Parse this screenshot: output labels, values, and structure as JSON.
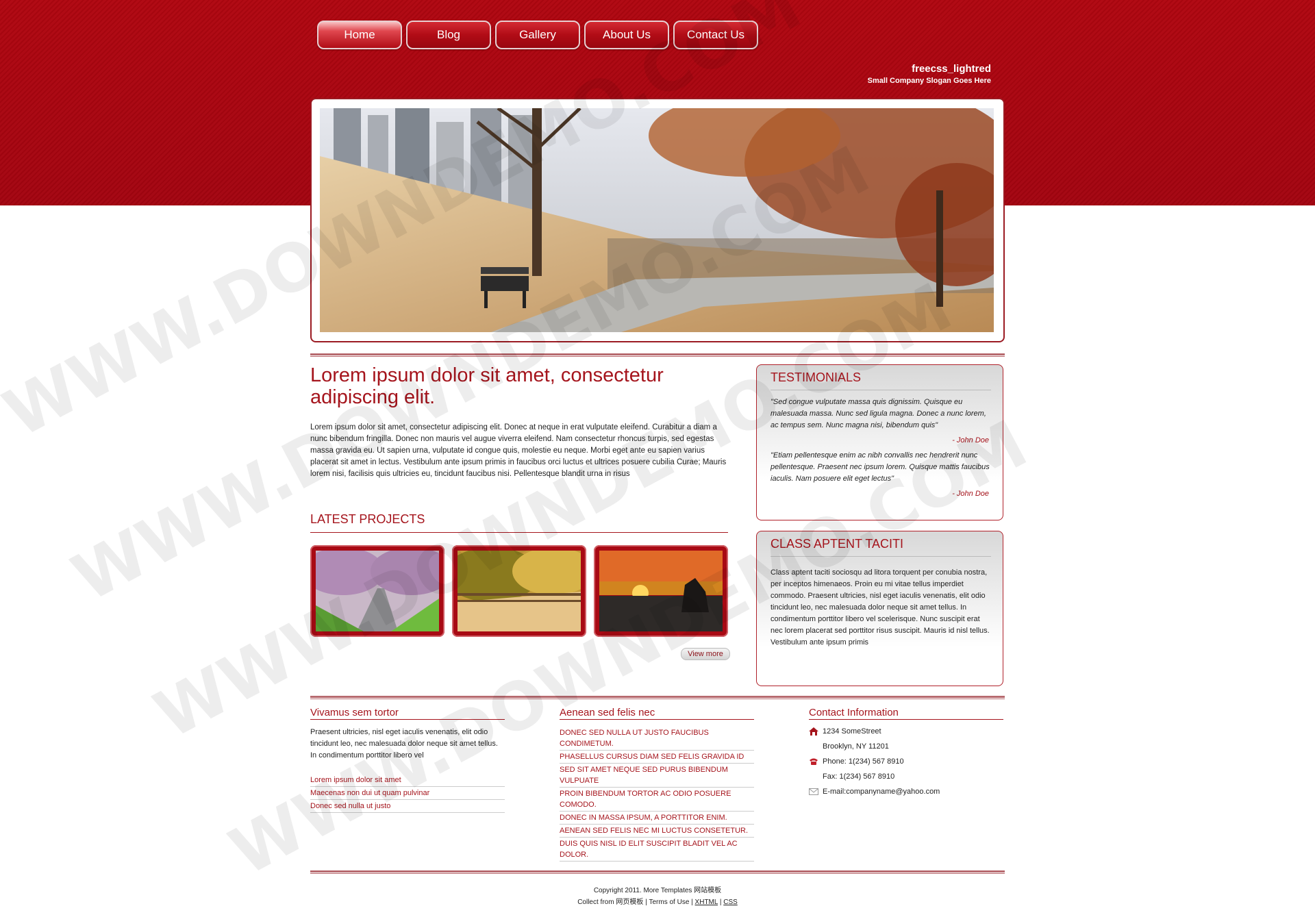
{
  "nav": [
    {
      "label": "Home",
      "active": true
    },
    {
      "label": "Blog"
    },
    {
      "label": "Gallery"
    },
    {
      "label": "About Us"
    },
    {
      "label": "Contact Us"
    }
  ],
  "brand": {
    "name": "freecss_lightred",
    "slogan": "Small Company Slogan Goes Here"
  },
  "main": {
    "title": "Lorem ipsum dolor sit amet, consectetur adipiscing elit.",
    "text": "Lorem ipsum dolor sit amet, consectetur adipiscing elit. Donec at neque in erat vulputate eleifend. Curabitur a diam a nunc bibendum fringilla. Donec non mauris vel augue viverra eleifend. Nam consectetur rhoncus turpis, sed egestas massa gravida eu. Ut sapien urna, vulputate id congue quis, molestie eu neque. Morbi eget ante eu sapien varius placerat sit amet in lectus. Vestibulum ante ipsum primis in faucibus orci luctus et ultrices posuere cubilia Curae; Mauris lorem nisi, facilisis quis ultricies eu, tincidunt faucibus nisi. Pellentesque blandit urna in risus"
  },
  "projects": {
    "title": "LATEST PROJECTS",
    "view_more": "View more"
  },
  "testimonials": {
    "title": "TESTIMONIALS",
    "items": [
      {
        "quote": "\"Sed congue vulputate massa quis dignissim. Quisque eu malesuada massa. Nunc sed ligula magna. Donec a nunc lorem, ac tempus sem. Nunc magna nisi, bibendum quis\"",
        "author": "- John Doe"
      },
      {
        "quote": "\"Etiam pellentesque enim ac nibh convallis nec hendrerit nunc pellentesque. Praesent nec ipsum lorem. Quisque mattis faucibus iaculis. Nam posuere elit eget lectus\"",
        "author": "- John Doe"
      }
    ]
  },
  "class_box": {
    "title": "CLASS APTENT TACITI",
    "text": "Class aptent taciti sociosqu ad litora torquent per conubia nostra, per inceptos himenaeos. Proin eu mi vitae tellus imperdiet commodo. Praesent ultricies, nisl eget iaculis venenatis, elit odio tincidunt leo, nec malesuada dolor neque sit amet tellus. In condimentum porttitor libero vel scelerisque. Nunc suscipit erat nec lorem placerat sed porttitor risus suscipit. Mauris id nisl tellus. Vestibulum ante ipsum primis"
  },
  "footer": {
    "col1": {
      "title": "Vivamus sem tortor",
      "text": "Praesent ultricies, nisl eget iaculis venenatis, elit odio tincidunt leo, nec malesuada dolor neque sit amet tellus. In condimentum porttitor libero vel",
      "links": [
        "Lorem ipsum dolor sit amet",
        "Maecenas non dui ut quam pulvinar",
        "Donec sed nulla ut justo"
      ]
    },
    "col2": {
      "title": "Aenean sed felis nec",
      "links": [
        "DONEC SED NULLA UT JUSTO FAUCIBUS CONDIMETUM.",
        "PHASELLUS CURSUS DIAM SED FELIS GRAVIDA ID",
        "SED SIT AMET NEQUE SED PURUS BIBENDUM VULPUATE",
        "PROIN BIBENDUM TORTOR AC ODIO POSUERE COMODO.",
        "DONEC IN MASSA IPSUM, A PORTTITOR ENIM.",
        "AENEAN SED FELIS NEC MI LUCTUS CONSETETUR.",
        "DUIS QUIS NISL ID ELIT SUSCIPIT BLADIT VEL AC DOLOR."
      ]
    },
    "col3": {
      "title": "Contact Information",
      "address1": "1234 SomeStreet",
      "address2": "Brooklyn, NY 11201",
      "phone": "Phone: 1(234) 567 8910",
      "fax": "Fax: 1(234) 567 8910",
      "email": "E-mail:companyname@yahoo.com"
    },
    "copyright": "Copyright 2011. More Templates 网站模板",
    "collect": "Collect from 网页模板",
    "terms": "Terms of Use",
    "xhtml": "XHTML",
    "css": "CSS"
  },
  "watermark": "WWW.DOWNDEMO.COM",
  "colors": {
    "brand_red": "#a5141c",
    "band_red": "#b00610"
  },
  "icons": [
    "home-icon",
    "phone-icon",
    "envelope-icon"
  ]
}
